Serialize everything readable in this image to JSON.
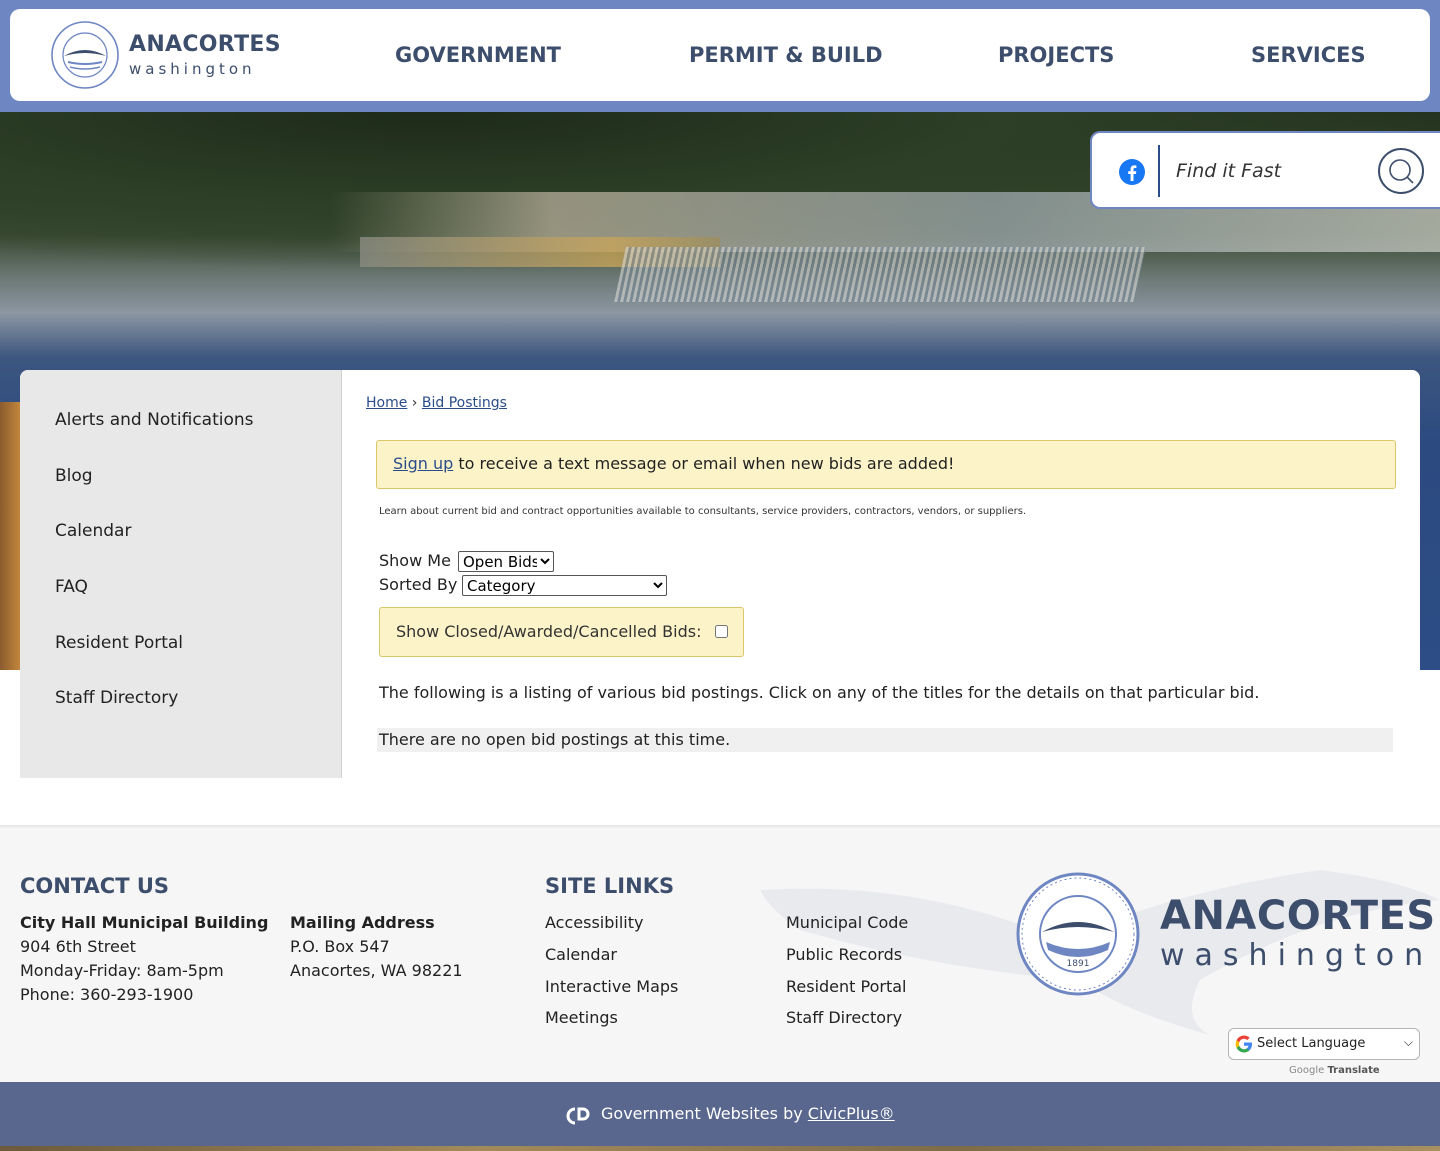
{
  "header": {
    "logo_name": "ANACORTES",
    "logo_state": "washington",
    "nav": [
      {
        "label": "GOVERNMENT"
      },
      {
        "label": "PERMIT & BUILD"
      },
      {
        "label": "PROJECTS"
      },
      {
        "label": "SERVICES"
      }
    ]
  },
  "search": {
    "placeholder": "Find it Fast",
    "social_icon": "facebook-icon",
    "button_icon": "search-icon"
  },
  "sidebar": {
    "items": [
      {
        "label": "Alerts and Notifications"
      },
      {
        "label": "Blog"
      },
      {
        "label": "Calendar"
      },
      {
        "label": "FAQ"
      },
      {
        "label": "Resident Portal"
      },
      {
        "label": "Staff Directory"
      }
    ]
  },
  "breadcrumb": {
    "home": "Home",
    "separator": "›",
    "current": "Bid Postings"
  },
  "alert": {
    "link": "Sign up",
    "text": " to receive a text message or email when new bids are added!"
  },
  "intro": "Learn about current bid and contract opportunities available to consultants, service providers, contractors, vendors, or suppliers.",
  "filters": {
    "show_me_label": "Show Me",
    "show_me_value": "Open Bids",
    "sorted_by_label": "Sorted By",
    "sorted_by_value": "Category",
    "closed_label": "Show Closed/Awarded/Cancelled Bids:",
    "closed_checked": false
  },
  "listing_text": "The following is a listing of various bid postings. Click on any of the titles for the details on that particular bid.",
  "no_bids_text": "There are no open bid postings at this time.",
  "footer": {
    "contact_heading": "CONTACT US",
    "city_hall_title": "City Hall Municipal Building",
    "city_hall_lines": [
      "904 6th Street",
      "Monday-Friday: 8am-5pm",
      "Phone: 360-293-1900"
    ],
    "mailing_title": "Mailing Address",
    "mailing_lines": [
      "P.O. Box 547",
      "Anacortes, WA 98221"
    ],
    "site_links_heading": "SITE LINKS",
    "links_col1": [
      "Accessibility",
      "Calendar",
      "Interactive Maps",
      "Meetings"
    ],
    "links_col2": [
      "Municipal Code",
      "Public Records",
      "Resident Portal",
      "Staff Directory"
    ],
    "logo_name": "ANACORTES",
    "logo_state": "washington",
    "seal_year": "1891"
  },
  "translate": {
    "select_label": "Select Language",
    "powered_google": "Google",
    "powered_translate": "Translate"
  },
  "bottom": {
    "text": "Government Websites by ",
    "link": "CivicPlus®"
  },
  "colors": {
    "brand_navy": "#3d4e6c",
    "top_band": "#6e86c2",
    "link_blue": "#2a4d8a",
    "alert_bg": "#fcf4c8",
    "bottom_bar": "#59678f"
  }
}
